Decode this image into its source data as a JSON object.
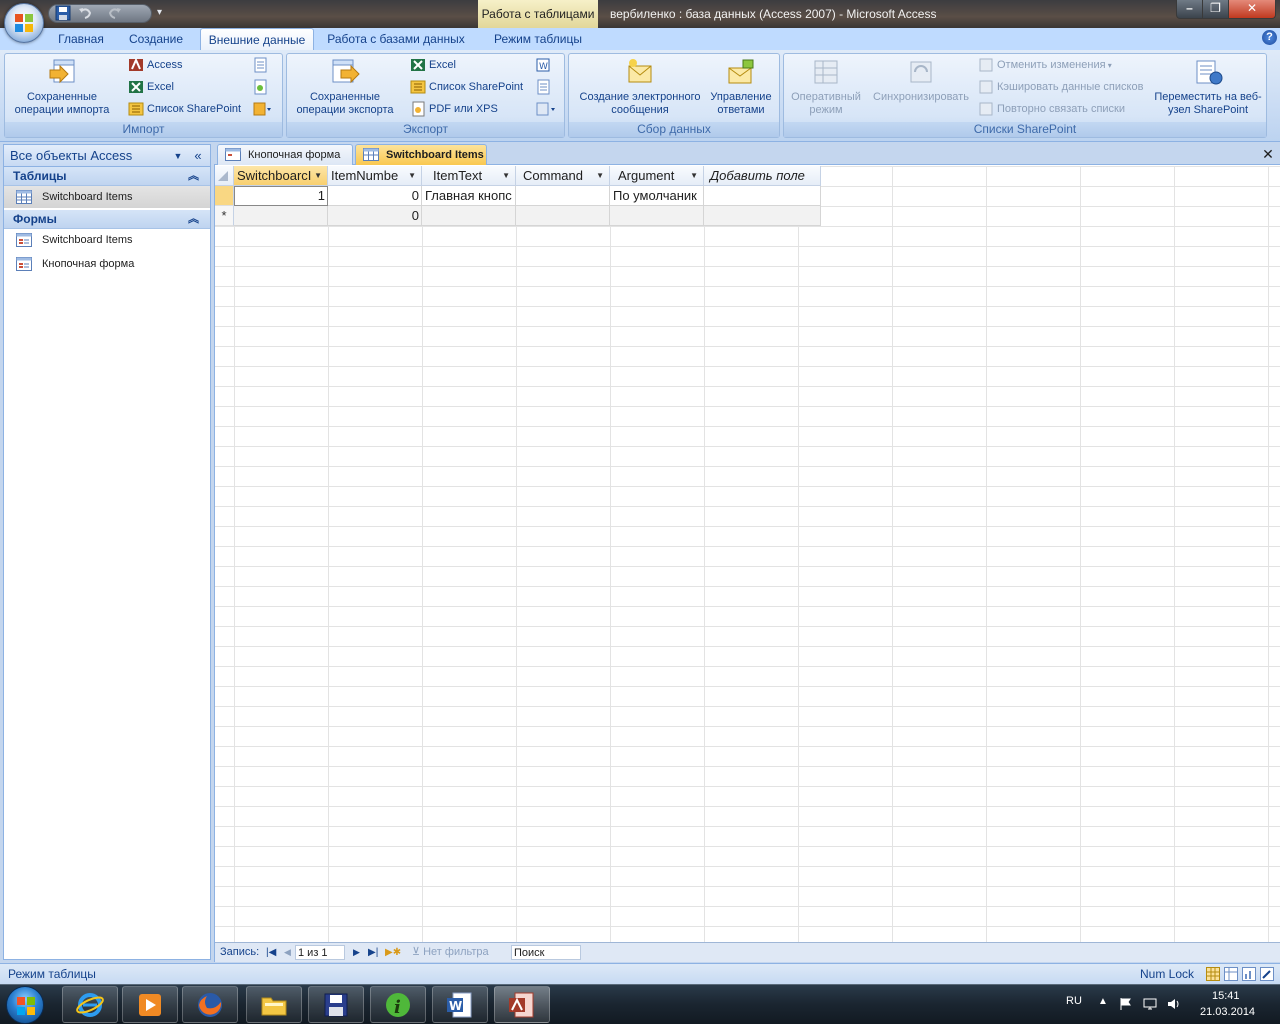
{
  "window": {
    "context_tab_title": "Работа с таблицами",
    "title": "вербиленко : база данных (Access 2007) - Microsoft Access"
  },
  "ribbon_tabs": [
    "Главная",
    "Создание",
    "Внешние данные",
    "Работа с базами данных",
    "Режим таблицы"
  ],
  "active_tab_index": 2,
  "groups": {
    "import": {
      "label": "Импорт",
      "saved_import": "Сохраненные операции импорта",
      "access": "Access",
      "excel": "Excel",
      "sharepoint_list": "Список SharePoint"
    },
    "export": {
      "label": "Экспорт",
      "saved_export": "Сохраненные операции экспорта",
      "excel": "Excel",
      "sharepoint_list": "Список SharePoint",
      "pdf_xps": "PDF или XPS"
    },
    "collect": {
      "label": "Сбор данных",
      "create_email": "Создание электронного сообщения",
      "manage_replies": "Управление ответами"
    },
    "sharepoint": {
      "label": "Списки SharePoint",
      "offline_mode": "Оперативный режим",
      "synchronize": "Синхронизировать",
      "discard_changes": "Отменить изменения",
      "cache_lists": "Кэшировать данные списков",
      "relink_lists": "Повторно связать списки",
      "move_to_sharepoint": "Переместить на веб-узел SharePoint"
    }
  },
  "nav": {
    "title": "Все объекты Access",
    "groups": [
      {
        "label": "Таблицы",
        "items": [
          "Switchboard Items"
        ]
      },
      {
        "label": "Формы",
        "items": [
          "Switchboard Items",
          "Кнопочная форма"
        ]
      }
    ]
  },
  "doc_tabs": [
    "Кнопочная форма",
    "Switchboard Items"
  ],
  "active_doc_tab": 1,
  "table": {
    "columns": [
      "SwitchboarcI",
      "ItemNumbe",
      "ItemText",
      "Command",
      "Argument",
      "Добавить поле"
    ],
    "rows": [
      [
        "1",
        "0",
        "Главная кнопс",
        "",
        "По умолчаник"
      ],
      [
        "",
        "0",
        "",
        "",
        ""
      ]
    ],
    "new_row_marker": "*"
  },
  "record_nav": {
    "label": "Запись:",
    "current": "1 из 1",
    "filter": "Нет фильтра",
    "search_placeholder": "Поиск"
  },
  "status": {
    "left": "Режим таблицы",
    "numlock": "Num Lock"
  },
  "taskbar": {
    "lang": "RU",
    "time": "15:41",
    "date": "21.03.2014"
  }
}
